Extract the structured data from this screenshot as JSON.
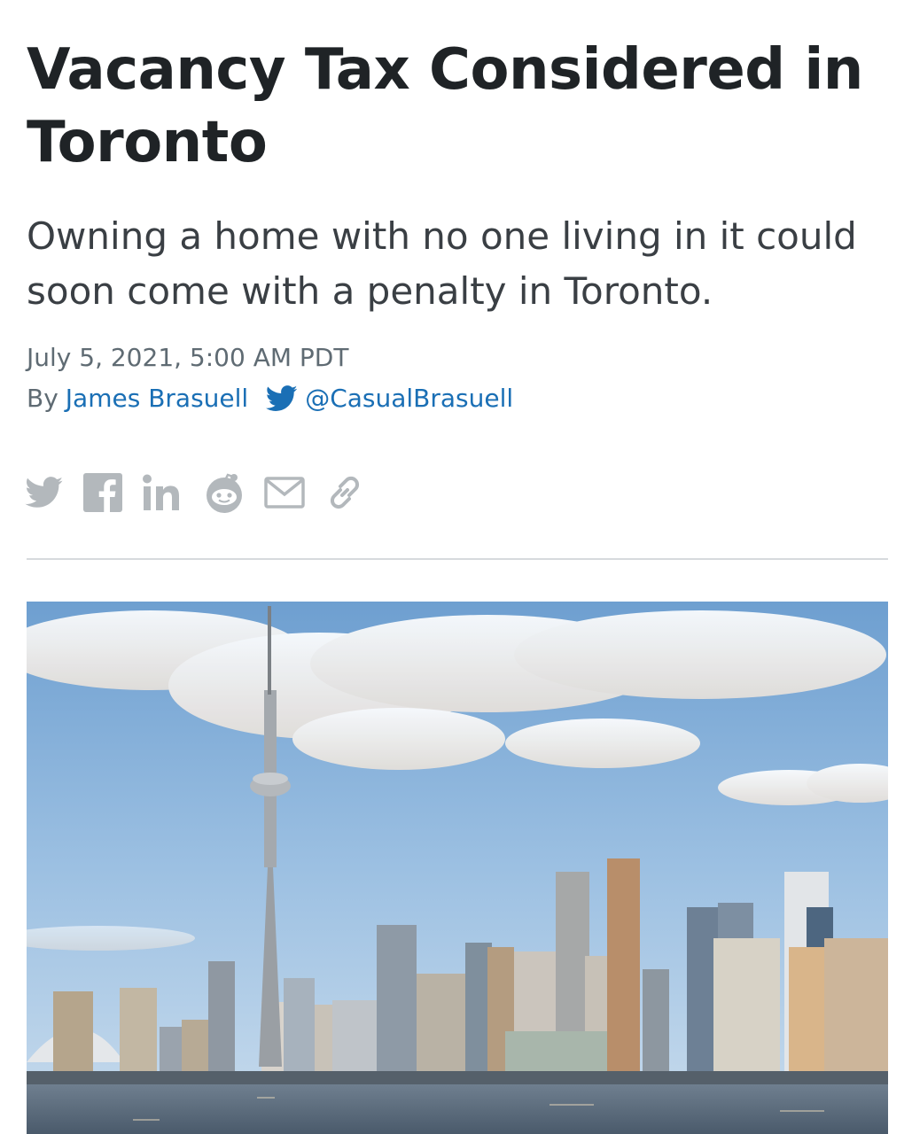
{
  "article": {
    "headline": "Vacancy Tax Considered in Toronto",
    "subheadline": "Owning a home with no one living in it could soon come with a penalty in Toronto.",
    "date": "July 5, 2021, 5:00 AM PDT",
    "byline": {
      "prefix": "By",
      "author": "James Brasuell",
      "twitter_handle": "@CasualBrasuell"
    }
  },
  "share": {
    "icons": [
      "twitter-icon",
      "facebook-icon",
      "linkedin-icon",
      "reddit-icon",
      "email-icon",
      "link-icon"
    ],
    "icon_color": "#b3b8bc"
  },
  "colors": {
    "headline": "#1f2326",
    "body_text": "#3a3f44",
    "meta_text": "#5f6b73",
    "link": "#1a6fb5"
  }
}
